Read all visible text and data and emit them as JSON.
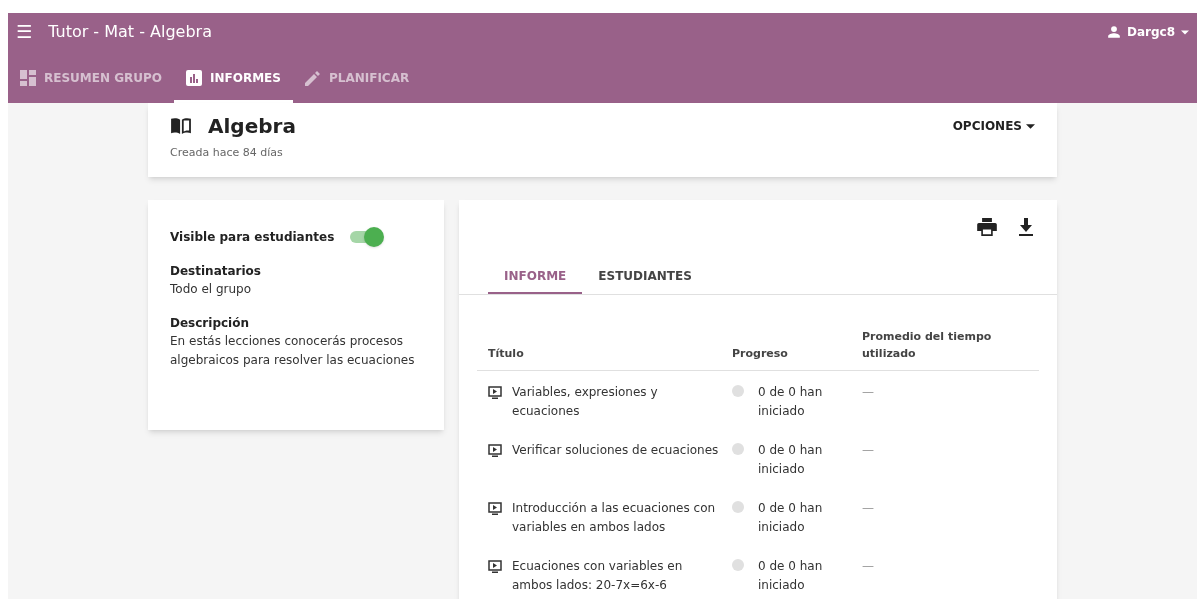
{
  "app_bar": {
    "menu_icon": "☰",
    "title": "Tutor - Mat - Algebra",
    "user": "Dargc8"
  },
  "nav_tabs": [
    {
      "label": "RESUMEN GRUPO",
      "kind": "dashboard",
      "selected": false
    },
    {
      "label": "INFORMES",
      "kind": "chart",
      "selected": true
    },
    {
      "label": "PLANIFICAR",
      "kind": "pencil",
      "selected": false
    }
  ],
  "lesson": {
    "title": "Algebra",
    "created": "Creada hace 84 días",
    "options_label": "OPCIONES"
  },
  "details": {
    "visible_label": "Visible para estudiantes",
    "visible": true,
    "recipients_label": "Destinatarios",
    "recipients": "Todo el grupo",
    "description_label": "Descripción",
    "description": "En estás lecciones conocerás procesos algebraicos para resolver las ecuaciones"
  },
  "report_tabs": [
    {
      "label": "INFORME",
      "selected": true
    },
    {
      "label": "ESTUDIANTES",
      "selected": false
    }
  ],
  "table": {
    "columns": [
      "Título",
      "Progreso",
      "Promedio del tiempo utilizado"
    ],
    "rows": [
      {
        "title": "Variables, expresiones y ecuaciones",
        "progress": "0 de 0 han iniciado",
        "time": "—"
      },
      {
        "title": "Verificar soluciones de ecuaciones",
        "progress": "0 de 0 han iniciado",
        "time": "—"
      },
      {
        "title": "Introducción a las ecuaciones con variables en ambos lados",
        "progress": "0 de 0 han iniciado",
        "time": "—"
      },
      {
        "title": "Ecuaciones con variables en ambos lados: 20-7x=6x-6",
        "progress": "0 de 0 han iniciado",
        "time": "—"
      }
    ]
  }
}
